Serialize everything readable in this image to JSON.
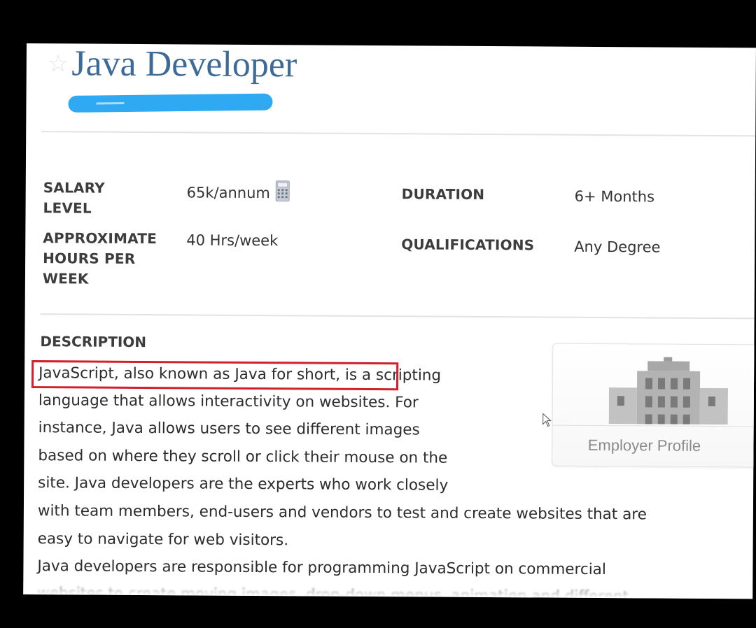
{
  "job": {
    "title": "Java Developer"
  },
  "details": {
    "salary_label_1": "SALARY",
    "salary_label_2": "LEVEL",
    "salary_value": "65k/annum",
    "duration_label": "DURATION",
    "duration_value": "6+ Months",
    "hours_label_1": "APPROXIMATE",
    "hours_label_2": "HOURS PER",
    "hours_label_3": "WEEK",
    "hours_value": "40 Hrs/week",
    "qualifications_label": "QUALIFICATIONS",
    "qualifications_value": "Any Degree"
  },
  "description": {
    "heading": "DESCRIPTION",
    "lines": [
      "JavaScript, also known as Java for short, is a scripting",
      "language that allows interactivity on websites. For",
      "instance, Java allows users to see different images",
      "based on where they scroll or click their mouse on the",
      "site. Java developers are the experts who work closely",
      "with team members, end-users and vendors to test and create websites that are",
      "easy to navigate for web visitors.",
      "Java developers are responsible for programming JavaScript on commercial",
      "websites to create moving images, drop-down menus, animation and different"
    ]
  },
  "employer": {
    "label": "Employer Profile"
  },
  "colors": {
    "title": "#3d6a96",
    "redaction": "#2fa9f2",
    "highlight_box": "#d0202a"
  },
  "icons": {
    "favorite": "star-icon",
    "salary": "calculator-icon",
    "employer": "building-icon",
    "pointer": "mouse-cursor-icon"
  }
}
